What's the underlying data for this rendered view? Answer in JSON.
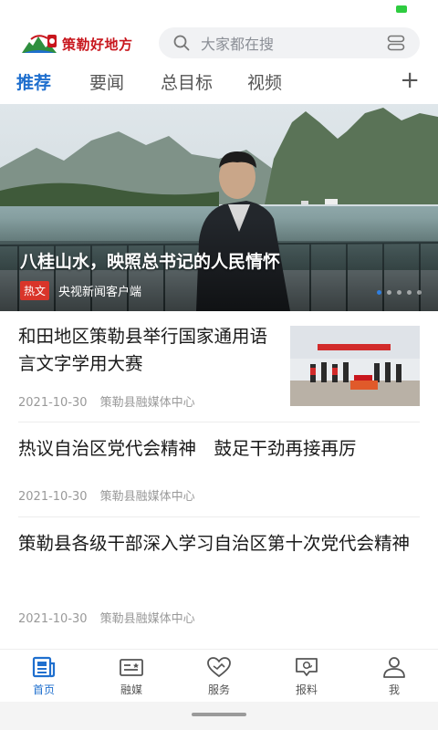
{
  "app": {
    "logo_text": "策勒好地方"
  },
  "search": {
    "placeholder": "大家都在搜"
  },
  "tabs": [
    {
      "label": "推荐",
      "active": true
    },
    {
      "label": "要闻",
      "active": false
    },
    {
      "label": "总目标",
      "active": false
    },
    {
      "label": "视频",
      "active": false
    }
  ],
  "tab_add": "+",
  "banner": {
    "title": "八桂山水，映照总书记的人民情怀",
    "tag": "热文",
    "source": "央视新闻客户端",
    "slide_count": 5,
    "active_slide": 1
  },
  "articles": [
    {
      "title": "和田地区策勒县举行国家通用语言文字学用大赛",
      "date": "2021-10-30",
      "source": "策勒县融媒体中心",
      "has_thumbnail": true
    },
    {
      "title": "热议自治区党代会精神　鼓足干劲再接再厉",
      "date": "2021-10-30",
      "source": "策勒县融媒体中心",
      "has_thumbnail": false
    },
    {
      "title": "策勒县各级干部深入学习自治区第十次党代会精神",
      "date": "2021-10-30",
      "source": "策勒县融媒体中心",
      "has_thumbnail": false
    }
  ],
  "bottom_nav": [
    {
      "label": "首页",
      "icon": "news-home-icon",
      "active": true
    },
    {
      "label": "融媒",
      "icon": "media-card-icon",
      "active": false
    },
    {
      "label": "服务",
      "icon": "heart-service-icon",
      "active": false
    },
    {
      "label": "报料",
      "icon": "report-chat-icon",
      "active": false
    },
    {
      "label": "我",
      "icon": "user-profile-icon",
      "active": false
    }
  ],
  "colors": {
    "accent": "#1f6fce",
    "brand_red": "#c8161d",
    "hot_tag": "#d9352a",
    "battery": "#2ecc40"
  }
}
